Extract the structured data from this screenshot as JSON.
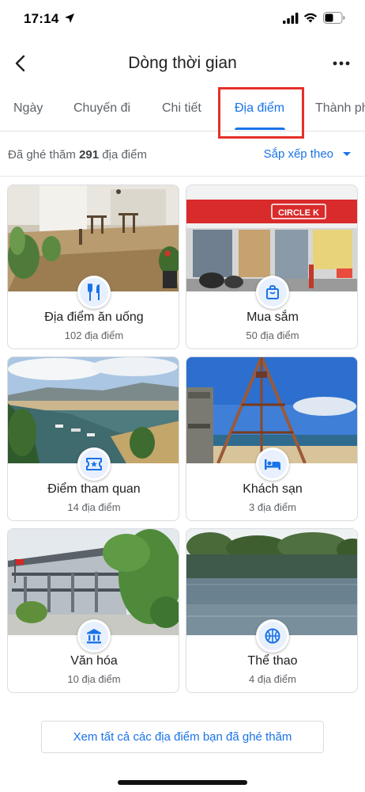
{
  "status_bar": {
    "time": "17:14"
  },
  "header": {
    "title": "Dòng thời gian",
    "back_icon": "chevron-left-icon",
    "more_icon": "more-horizontal-icon"
  },
  "tabs": [
    {
      "label": "Ngày",
      "active": false
    },
    {
      "label": "Chuyến đi",
      "active": false
    },
    {
      "label": "Chi tiết",
      "active": false
    },
    {
      "label": "Địa điểm",
      "active": true
    },
    {
      "label": "Thành ph",
      "active": false
    }
  ],
  "summary": {
    "prefix": "Đã ghé thăm",
    "count": "291",
    "suffix": "địa điểm",
    "sort_label": "Sắp xếp theo"
  },
  "categories": [
    {
      "title": "Địa điểm ăn uống",
      "count": "102 địa điểm",
      "icon": "fork-knife-icon"
    },
    {
      "title": "Mua sắm",
      "count": "50 địa điểm",
      "icon": "shopping-bag-icon"
    },
    {
      "title": "Điểm tham quan",
      "count": "14 địa điểm",
      "icon": "ticket-icon"
    },
    {
      "title": "Khách sạn",
      "count": "3 địa điểm",
      "icon": "bed-icon"
    },
    {
      "title": "Văn hóa",
      "count": "10 địa điểm",
      "icon": "museum-icon"
    },
    {
      "title": "Thể thao",
      "count": "4 địa điểm",
      "icon": "basketball-icon"
    }
  ],
  "photos": {
    "shopping_sign": "CIRCLE K"
  },
  "see_all_label": "Xem tất cả các địa điểm bạn đã ghé thăm",
  "colors": {
    "accent": "#1a73e8",
    "highlight": "#e5302a",
    "icon_bg": "#e8f0fe"
  }
}
